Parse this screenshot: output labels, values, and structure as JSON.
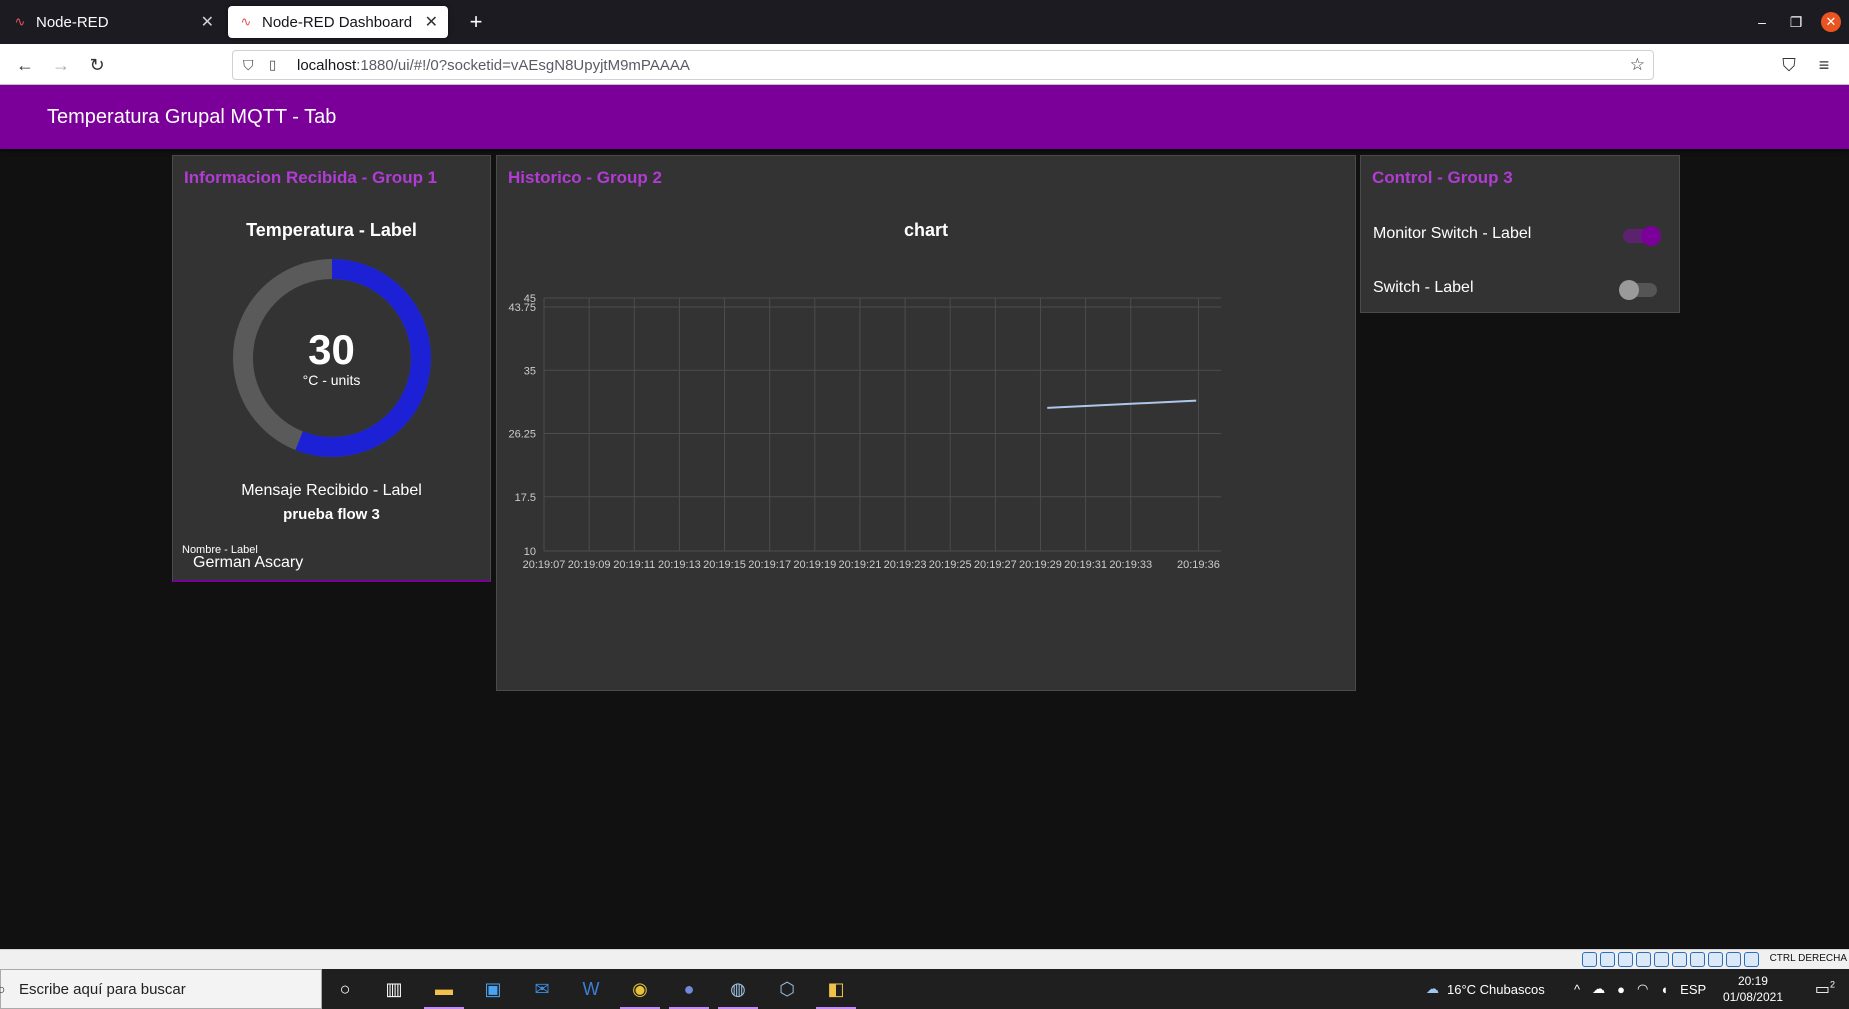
{
  "browser": {
    "tabs": [
      {
        "title": "Node-RED",
        "active": false
      },
      {
        "title": "Node-RED Dashboard",
        "active": true
      }
    ],
    "url_host": "localhost",
    "url_rest": ":1880/ui/#!/0?socketid=vAEsgN8UpyjtM9mPAAAA"
  },
  "dashboard": {
    "title": "Temperatura Grupal MQTT - Tab",
    "accent": "#7b0099",
    "group1": {
      "title": "Informacion Recibida - Group 1",
      "gauge": {
        "label": "Temperatura - Label",
        "value": "30",
        "units": "°C - units",
        "fraction": 0.56,
        "color": "#1c21d6"
      },
      "message_label": "Mensaje Recibido - Label",
      "message_value": "prueba flow 3",
      "name_label": "Nombre - Label",
      "name_value": "German Ascary"
    },
    "group2": {
      "title": "Historico - Group 2"
    },
    "group3": {
      "title": "Control - Group 3",
      "switches": [
        {
          "label": "Monitor Switch - Label",
          "state": "on"
        },
        {
          "label": "Switch - Label",
          "state": "off"
        }
      ]
    }
  },
  "chart_data": {
    "type": "line",
    "title": "chart",
    "xlabel": "",
    "ylabel": "",
    "yticks": [
      "45",
      "43.75",
      "35",
      "26.25",
      "17.5",
      "10"
    ],
    "ylim": [
      10,
      45
    ],
    "xticks": [
      "20:19:07",
      "20:19:09",
      "20:19:11",
      "20:19:13",
      "20:19:15",
      "20:19:17",
      "20:19:19",
      "20:19:21",
      "20:19:23",
      "20:19:25",
      "20:19:27",
      "20:19:29",
      "20:19:31",
      "20:19:33",
      "20:19:36"
    ],
    "xlim": [
      "20:19:07",
      "20:19:37"
    ],
    "grid": true,
    "series": [
      {
        "color": "#aec7e8",
        "x": [
          "20:19:29.3",
          "20:19:35.9"
        ],
        "y": [
          29.8,
          30.8
        ]
      }
    ]
  },
  "os": {
    "search_placeholder": "Escribe aquí para buscar",
    "weather": "16°C  Chubascos",
    "lang": "ESP",
    "time": "20:19",
    "date": "01/08/2021",
    "notifications": "2",
    "vm_hostkey": "CTRL DERECHA"
  }
}
